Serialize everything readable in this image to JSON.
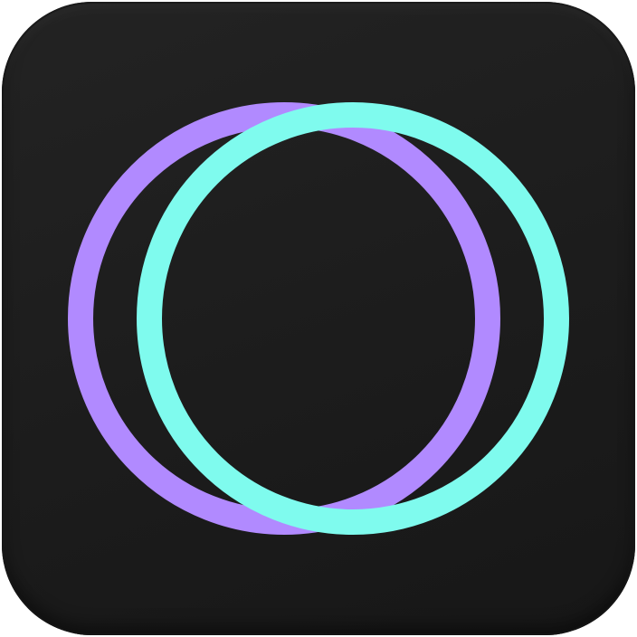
{
  "app_icon": {
    "name": "overlapping-rings-app-icon",
    "background_color": "#1c1c1c",
    "rings": [
      {
        "name": "purple-ring",
        "color": "#b18aff"
      },
      {
        "name": "teal-ring",
        "color": "#7ffbee"
      }
    ]
  }
}
